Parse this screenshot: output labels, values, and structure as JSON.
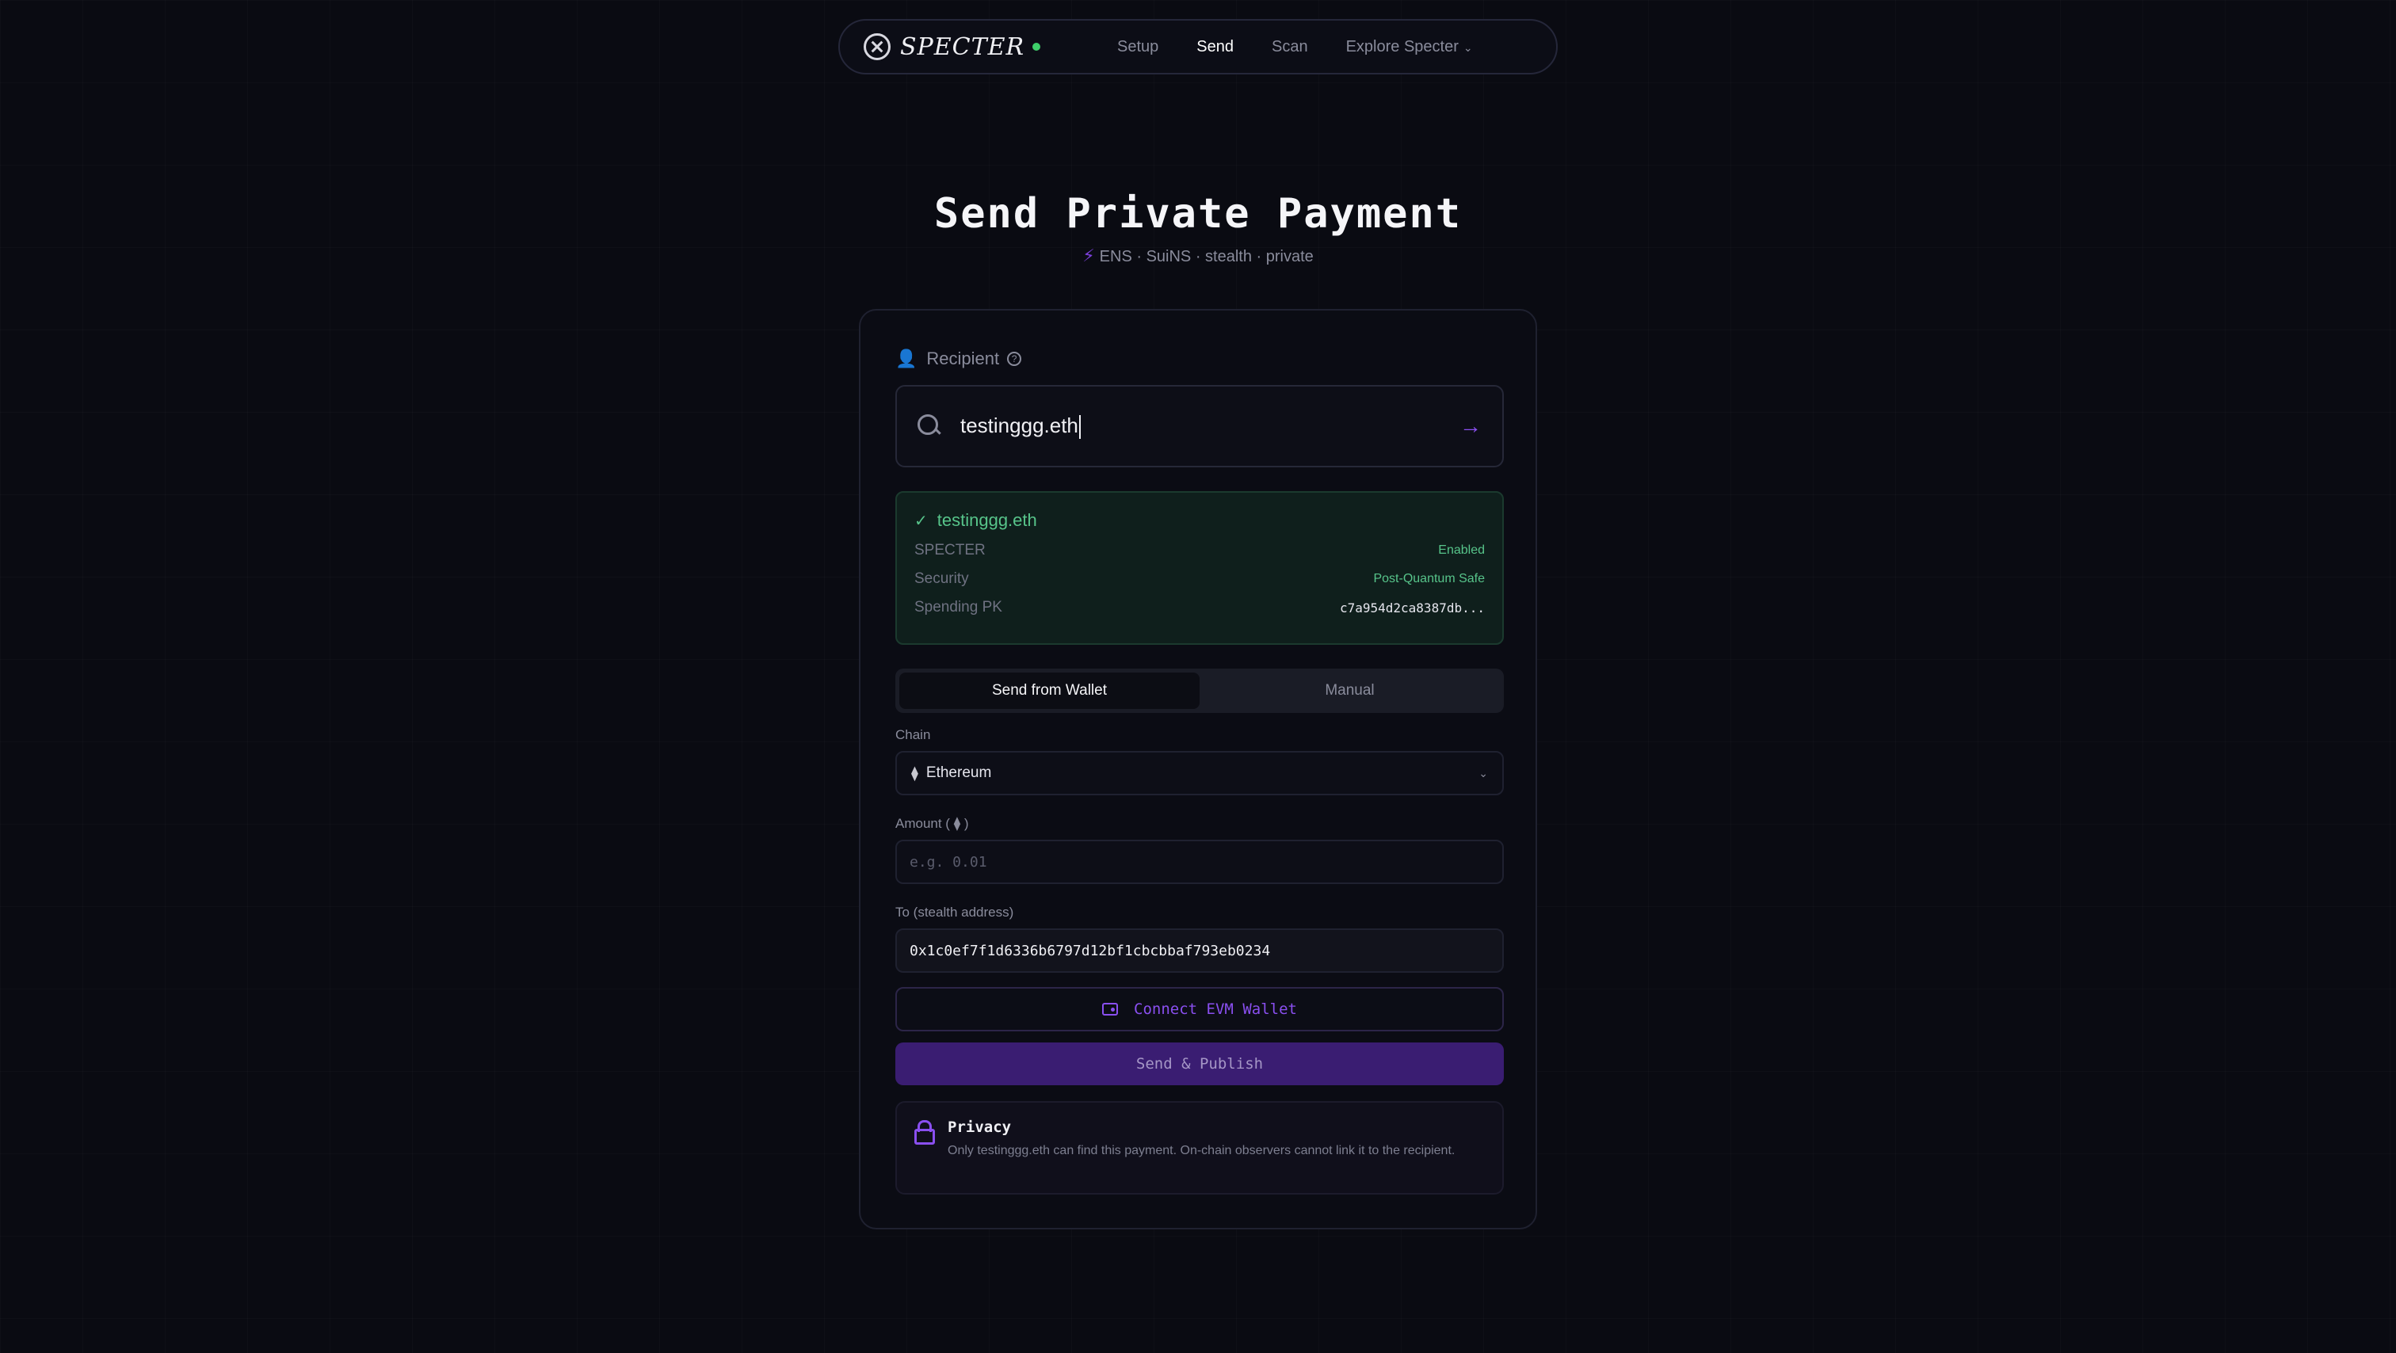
{
  "nav": {
    "brand": "SPECTER",
    "links": [
      "Setup",
      "Send",
      "Scan",
      "Explore Specter"
    ]
  },
  "page": {
    "title": "Send Private Payment",
    "subtitle": "ENS · SuiNS · stealth · private"
  },
  "recipient": {
    "label": "Recipient",
    "value": "testinggg.eth"
  },
  "resolved": {
    "name": "testinggg.eth",
    "rows": [
      {
        "key": "SPECTER",
        "value": "Enabled"
      },
      {
        "key": "Security",
        "value": "Post-Quantum Safe"
      },
      {
        "key": "Spending PK",
        "value": "c7a954d2ca8387db..."
      }
    ]
  },
  "mode": {
    "options": [
      "Send from Wallet",
      "Manual"
    ],
    "selected": "Send from Wallet"
  },
  "form": {
    "chain_label": "Chain",
    "chain_value": "Ethereum",
    "amount_label_prefix": "Amount (",
    "amount_label_suffix": ")",
    "amount_placeholder": "e.g. 0.01",
    "to_label": "To (stealth address)",
    "to_value": "0x1c0ef7f1d6336b6797d12bf1cbcbbaf793eb0234"
  },
  "actions": {
    "connect": "Connect EVM Wallet",
    "send": "Send & Publish"
  },
  "privacy": {
    "title": "Privacy",
    "text": "Only testinggg.eth can find this payment. On-chain observers cannot link it to the recipient."
  },
  "colors": {
    "accent": "#8a4ff0",
    "success": "#57c48a",
    "background": "#0a0b12"
  }
}
